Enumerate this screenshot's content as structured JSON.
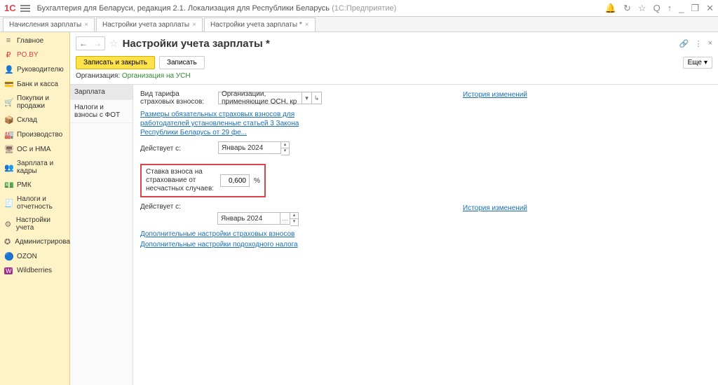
{
  "titlebar": {
    "app_title": "Бухгалтерия для Беларуси, редакция 2.1. Локализация для Республики Беларусь",
    "app_suffix": "(1С:Предприятие)"
  },
  "tabs": [
    {
      "label": "Начисления зарплаты"
    },
    {
      "label": "Настройки учета зарплаты"
    },
    {
      "label": "Настройки учета зарплаты *"
    }
  ],
  "sidebar": {
    "items": [
      {
        "icon": "≡",
        "label": "Главное"
      },
      {
        "icon": "₽",
        "label": "PO.BY"
      },
      {
        "icon": "👤",
        "label": "Руководителю"
      },
      {
        "icon": "💳",
        "label": "Банк и касса"
      },
      {
        "icon": "🛒",
        "label": "Покупки и продажи"
      },
      {
        "icon": "📦",
        "label": "Склад"
      },
      {
        "icon": "🏭",
        "label": "Производство"
      },
      {
        "icon": "🖥",
        "label": "ОС и НМА"
      },
      {
        "icon": "👥",
        "label": "Зарплата и кадры"
      },
      {
        "icon": "💵",
        "label": "РМК"
      },
      {
        "icon": "🧾",
        "label": "Налоги и отчетность"
      },
      {
        "icon": "⚙",
        "label": "Настройки учета"
      },
      {
        "icon": "✪",
        "label": "Администрирование"
      },
      {
        "icon": "🔵",
        "label": "OZON"
      },
      {
        "icon": "W",
        "label": "Wildberries"
      }
    ]
  },
  "page": {
    "title": "Настройки учета зарплаты *",
    "btn_save_close": "Записать и закрыть",
    "btn_save": "Записать",
    "btn_more": "Еще",
    "org_label": "Организация:",
    "org_value": "Организация на УСН"
  },
  "form": {
    "tabs": [
      {
        "label": "Зарплата"
      },
      {
        "label": "Налоги и взносы с ФОТ"
      }
    ],
    "tariff_label": "Вид тарифа страховых взносов:",
    "tariff_value": "Организации, применяющие ОСН, кр",
    "law_link": "Размеры обязательных страховых взносов для работодателей установленные статьей 3 Закона Республики Беларусь от 29 фе...",
    "effective_label": "Действует с:",
    "effective_value1": "Январь 2024",
    "history_link": "История изменений",
    "rate_label": "Ставка взноса на страхование от несчастных случаев:",
    "rate_value": "0,600",
    "effective_value2": "Январь 2024",
    "extra_link1": "Дополнительные настройки страховых взносов",
    "extra_link2": "Дополнительные настройки подоходного налога"
  }
}
